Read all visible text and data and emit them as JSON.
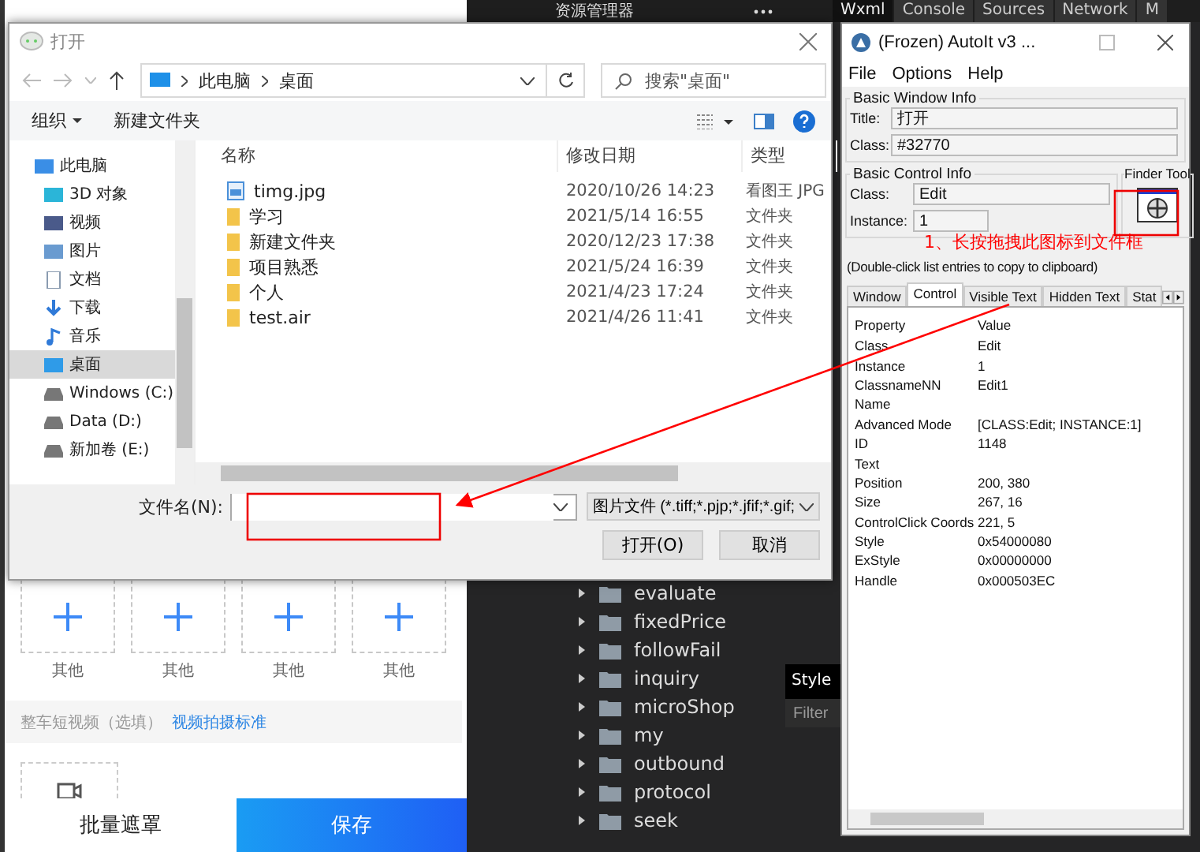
{
  "left_page": {
    "upload_tiles": [
      {
        "label": "其他"
      },
      {
        "label": "其他"
      },
      {
        "label": "其他"
      },
      {
        "label": "其他"
      }
    ],
    "video_section": {
      "label": "整车短视频（选填）",
      "link": "视频拍摄标准"
    },
    "footer_buttons": [
      {
        "label": "批量遮罩",
        "kind": "plain"
      },
      {
        "label": "保存",
        "kind": "primary"
      }
    ]
  },
  "devtools": {
    "explorer_title": "资源管理器",
    "tabs": [
      {
        "label": "Wxml",
        "selected": true
      },
      {
        "label": "Console",
        "selected": false
      },
      {
        "label": "Sources",
        "selected": false
      },
      {
        "label": "Network",
        "selected": false
      },
      {
        "label": "M",
        "selected": false
      }
    ],
    "folder_tree": [
      {
        "name": "evaluate",
        "expanded": false
      },
      {
        "name": "fixedPrice",
        "expanded": false
      },
      {
        "name": "followFail",
        "expanded": false
      },
      {
        "name": "inquiry",
        "expanded": false
      },
      {
        "name": "microShop",
        "expanded": false
      },
      {
        "name": "my",
        "expanded": false
      },
      {
        "name": "outbound",
        "expanded": false
      },
      {
        "name": "protocol",
        "expanded": false
      },
      {
        "name": "seek",
        "expanded": false
      }
    ],
    "styles_tab": "Style",
    "filter_placeholder": "Filter"
  },
  "open_dialog": {
    "title": "打开",
    "breadcrumb": [
      "此电脑",
      "桌面"
    ],
    "search_placeholder": "搜索\"桌面\"",
    "toolbar": [
      {
        "label": "组织",
        "kind": "menu"
      },
      {
        "label": "新建文件夹",
        "kind": "plain"
      }
    ],
    "sidebar": [
      {
        "label": "此电脑",
        "kind": "computer",
        "selected": false
      },
      {
        "label": "3D 对象",
        "kind": "cube",
        "selected": false
      },
      {
        "label": "视频",
        "kind": "video",
        "selected": false
      },
      {
        "label": "图片",
        "kind": "picture",
        "selected": false
      },
      {
        "label": "文档",
        "kind": "document",
        "selected": false
      },
      {
        "label": "下载",
        "kind": "download",
        "selected": false
      },
      {
        "label": "音乐",
        "kind": "music",
        "selected": false
      },
      {
        "label": "桌面",
        "kind": "desktop",
        "selected": true
      },
      {
        "label": "Windows (C:)",
        "kind": "drive",
        "selected": false
      },
      {
        "label": "Data (D:)",
        "kind": "drive",
        "selected": false
      },
      {
        "label": "新加卷 (E:)",
        "kind": "drive",
        "selected": false
      }
    ],
    "columns": [
      "名称",
      "修改日期",
      "类型"
    ],
    "files": [
      {
        "name": "timg.jpg",
        "kind": "image",
        "modified": "2020/10/26 14:23",
        "type": "看图王 JPG"
      },
      {
        "name": "学习",
        "kind": "folder",
        "modified": "2021/5/14 16:55",
        "type": "文件夹"
      },
      {
        "name": "新建文件夹",
        "kind": "folder",
        "modified": "2020/12/23 17:38",
        "type": "文件夹"
      },
      {
        "name": "项目熟悉",
        "kind": "folder",
        "modified": "2021/5/24 16:39",
        "type": "文件夹"
      },
      {
        "name": "个人",
        "kind": "folder",
        "modified": "2021/4/23 17:24",
        "type": "文件夹"
      },
      {
        "name": "test.air",
        "kind": "folder",
        "modified": "2021/4/26 11:41",
        "type": "文件夹"
      }
    ],
    "filename_label": "文件名(N):",
    "file_type_filter": "图片文件 (*.tiff;*.pjp;*.jfif;*.gif;",
    "buttons": [
      "打开(O)",
      "取消"
    ]
  },
  "autoit": {
    "title": "(Frozen) AutoIt v3 ...",
    "menu": [
      "File",
      "Options",
      "Help"
    ],
    "window_info": {
      "heading": "Basic Window Info",
      "fields": [
        {
          "label": "Title:",
          "value": "打开"
        },
        {
          "label": "Class:",
          "value": "#32770"
        }
      ]
    },
    "control_info": {
      "heading": "Basic Control Info",
      "fields": [
        {
          "label": "Class:",
          "value": "Edit"
        },
        {
          "label": "Instance:",
          "value": "1"
        }
      ]
    },
    "finder_tool": {
      "heading": "Finder Tool"
    },
    "hint": "(Double-click list entries to copy to clipboard)",
    "tabs": [
      {
        "label": "Window",
        "selected": false
      },
      {
        "label": "Control",
        "selected": true
      },
      {
        "label": "Visible Text",
        "selected": false
      },
      {
        "label": "Hidden Text",
        "selected": false
      },
      {
        "label": "Stat",
        "selected": false
      }
    ],
    "properties": {
      "columns": [
        "Property",
        "Value"
      ],
      "rows": [
        {
          "property": "Class",
          "value": "Edit"
        },
        {
          "property": "Instance",
          "value": "1"
        },
        {
          "property": "ClassnameNN",
          "value": "Edit1"
        },
        {
          "property": "Name"
        },
        {
          "property": "Advanced Mode",
          "value": "[CLASS:Edit; INSTANCE:1]"
        },
        {
          "property": "ID",
          "value": "1148"
        },
        {
          "property": "Text"
        },
        {
          "property": "Position",
          "value": "200, 380"
        },
        {
          "property": "Size",
          "value": "267, 16"
        },
        {
          "property": "ControlClick Coords",
          "value": "221, 5"
        },
        {
          "property": "Style",
          "value": "0x54000080"
        },
        {
          "property": "ExStyle",
          "value": "0x00000000"
        },
        {
          "property": "Handle",
          "value": "0x000503EC"
        }
      ]
    }
  },
  "annotation": {
    "text": "1、长按拖拽此图标到文件框"
  }
}
